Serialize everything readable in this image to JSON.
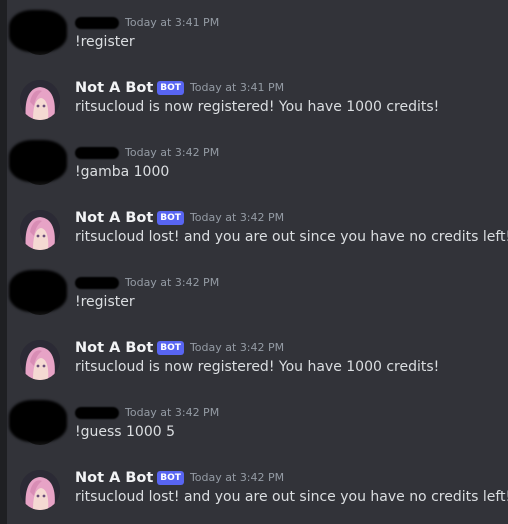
{
  "colors": {
    "background": "#323339",
    "bot_badge": "#5865f2",
    "name": "#f2f3f5",
    "timestamp": "#949ba4",
    "message_text": "#dbdee1"
  },
  "icons": {
    "bot_avatar": "pink-haired-anime-avatar-icon",
    "user_avatar": "redacted-avatar-icon"
  },
  "messages": [
    {
      "author": "",
      "bot": false,
      "badge": "",
      "time": "Today at 3:41 PM",
      "text": "!register"
    },
    {
      "author": "Not A Bot",
      "bot": true,
      "badge": "BOT",
      "time": "Today at 3:41 PM",
      "text": "ritsucloud is now registered! You have 1000 credits!"
    },
    {
      "author": "",
      "bot": false,
      "badge": "",
      "time": "Today at 3:42 PM",
      "text": "!gamba 1000"
    },
    {
      "author": "Not A Bot",
      "bot": true,
      "badge": "BOT",
      "time": "Today at 3:42 PM",
      "text": "ritsucloud lost! and you are out since you have no credits left!"
    },
    {
      "author": "",
      "bot": false,
      "badge": "",
      "time": "Today at 3:42 PM",
      "text": "!register"
    },
    {
      "author": "Not A Bot",
      "bot": true,
      "badge": "BOT",
      "time": "Today at 3:42 PM",
      "text": "ritsucloud is now registered! You have 1000 credits!"
    },
    {
      "author": "",
      "bot": false,
      "badge": "",
      "time": "Today at 3:42 PM",
      "text": "!guess 1000 5"
    },
    {
      "author": "Not A Bot",
      "bot": true,
      "badge": "BOT",
      "time": "Today at 3:42 PM",
      "text": "ritsucloud lost! and you are out since you have no credits left!"
    }
  ]
}
